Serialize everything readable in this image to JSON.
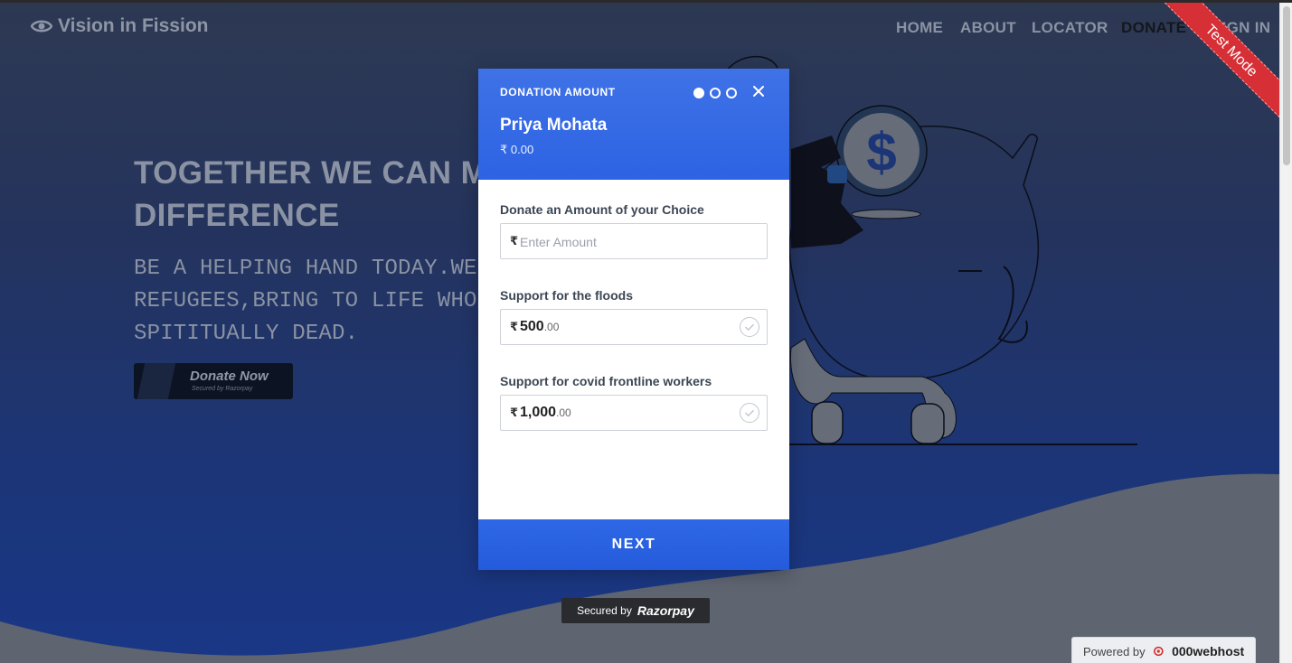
{
  "site": {
    "brand": "Vision in Fission",
    "nav": {
      "home": "HOME",
      "about": "ABOUT",
      "locator": "LOCATOR",
      "donate": "DONATE",
      "signin": "SIGN IN"
    },
    "hero": {
      "title": "TOGETHER WE CAN MAKE A DIFFERENCE",
      "subtitle": "BE A HELPING HAND TODAY.WE THE REFUGEES,BRING TO LIFE WHO ARE SPITITUALLY DEAD."
    },
    "donate_button": {
      "label": "Donate Now",
      "sublabel": "Secured by Razorpay"
    },
    "ribbon": "Test Mode",
    "secured_by": {
      "prefix": "Secured by",
      "brand": "Razorpay"
    },
    "powered_by": {
      "prefix": "Powered by",
      "brand": "000webhost"
    }
  },
  "modal": {
    "section_label": "DONATION AMOUNT",
    "steps": {
      "total": 3,
      "current": 1
    },
    "title": "Priya Mohata",
    "amount": "₹ 0.00",
    "currency_symbol": "₹",
    "fields": [
      {
        "label": "Donate an Amount of your Choice",
        "placeholder": "Enter Amount",
        "value_main": "",
        "value_decimal": ""
      },
      {
        "label": "Support for the floods",
        "placeholder": "",
        "value_main": "500",
        "value_decimal": ".00"
      },
      {
        "label": "Support for covid frontline workers",
        "placeholder": "",
        "value_main": "1,000",
        "value_decimal": ".00"
      }
    ],
    "next_label": "NEXT"
  },
  "colors": {
    "modal_header": "#3f72e6",
    "next_button": "#2f68e6",
    "ribbon": "#d72f36"
  }
}
